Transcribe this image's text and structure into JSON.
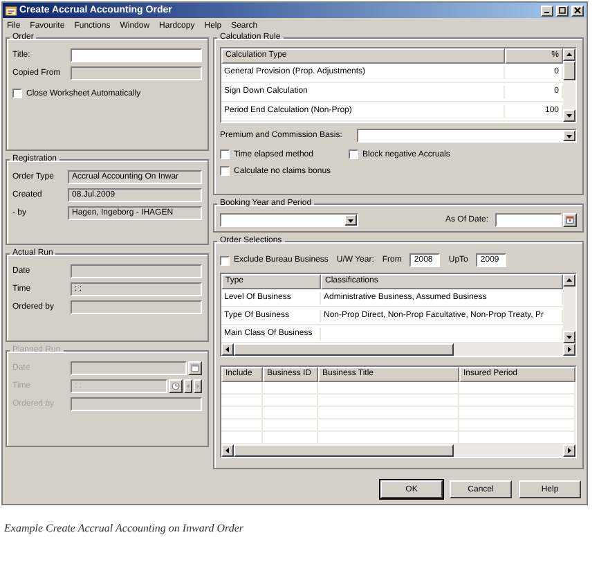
{
  "window": {
    "title": "Create Accrual Accounting Order"
  },
  "menu": [
    "File",
    "Favourite",
    "Functions",
    "Window",
    "Hardcopy",
    "Help",
    "Search"
  ],
  "order": {
    "title": "Order",
    "fields": [
      {
        "label": "Title:",
        "editable": true
      },
      {
        "label": "Copied From",
        "editable": false
      }
    ],
    "close_automatically": {
      "label": "Close Worksheet Automatically",
      "checked": false
    }
  },
  "registration": {
    "title": "Registration",
    "fields": [
      {
        "label": "Order Type",
        "value": "Accrual Accounting On Inwar"
      },
      {
        "label": "Created",
        "value": "08.Jul.2009"
      },
      {
        "label": "- by",
        "value": "Hagen, Ingeborg - IHAGEN"
      }
    ]
  },
  "actual_run": {
    "title": "Actual Run",
    "disabled": false,
    "fields": [
      {
        "label": "Date"
      },
      {
        "label": "Time",
        "value": ": :"
      },
      {
        "label": "Ordered by"
      }
    ]
  },
  "planned_run": {
    "title": "Planned Run",
    "disabled": true,
    "fields": [
      {
        "label": "Date",
        "kind": "date"
      },
      {
        "label": "Time",
        "value": ": :",
        "kind": "time"
      },
      {
        "label": "Ordered by",
        "kind": "text"
      }
    ]
  },
  "calculation_rule": {
    "title": "Calculation Rule",
    "columns": [
      "Calculation Type",
      "%"
    ],
    "rows": [
      {
        "type": "General Provision (Prop. Adjustments)",
        "percent": "0"
      },
      {
        "type": "Sign Down Calculation",
        "percent": "0"
      },
      {
        "type": "Period End Calculation (Non-Prop)",
        "percent": "100"
      }
    ],
    "premium_label": "Premium and Commission Basis:",
    "checkboxes": [
      {
        "label": "Time elapsed method",
        "checked": false
      },
      {
        "label": "Block negative Accruals",
        "checked": false
      },
      {
        "label": "Calculate no claims bonus",
        "checked": false
      }
    ]
  },
  "booking": {
    "title": "Booking Year and Period",
    "as_of_label": "As Of Date:"
  },
  "order_selections": {
    "title": "Order Selections",
    "exclude": {
      "label": "Exclude Bureau Business",
      "checked": false
    },
    "uw_year_label": "U/W Year:",
    "from_label": "From",
    "from_value": "2008",
    "upto_label": "UpTo",
    "upto_value": "2009",
    "classification_columns": [
      "Type",
      "Classifications"
    ],
    "classification_rows": [
      {
        "type": "Level Of Business",
        "classifications": "Administrative Business, Assumed Business"
      },
      {
        "type": "Type Of Business",
        "classifications": "Non-Prop Direct, Non-Prop Facultative, Non-Prop Treaty, Pr"
      },
      {
        "type": "Main Class Of Business",
        "classifications": ""
      }
    ],
    "business_columns": [
      "Include",
      "Business ID",
      "Business Title",
      "Insured Period"
    ]
  },
  "buttons": [
    "OK",
    "Cancel",
    "Help"
  ],
  "caption": "Example Create Accrual Accounting on Inward Order"
}
